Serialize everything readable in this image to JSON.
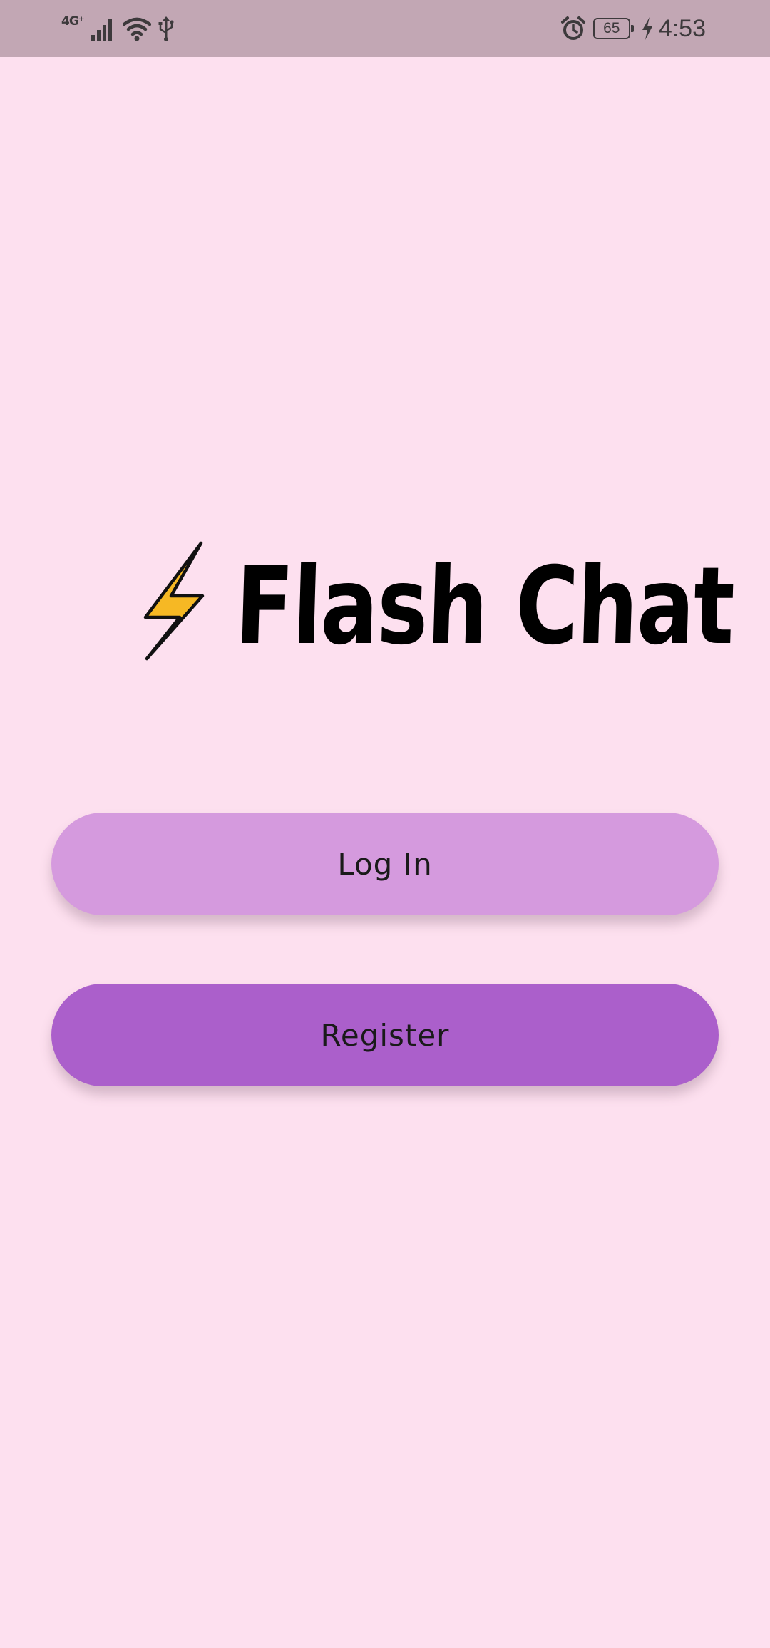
{
  "status_bar": {
    "network_label": "4G⁺",
    "battery_level": "65",
    "time": "4:53",
    "icons": [
      "signal-icon",
      "wifi-icon",
      "usb-icon",
      "alarm-icon",
      "battery-icon",
      "charging-icon"
    ]
  },
  "app": {
    "title": "Flash Chat",
    "logo_icon": "lightning-bolt-icon"
  },
  "buttons": {
    "login_label": "Log In",
    "register_label": "Register"
  },
  "colors": {
    "background": "#fde0ef",
    "status_bar": "#c2a7b4",
    "login_button": "#d59ade",
    "register_button": "#ab5fcb",
    "bolt_fill": "#f6b824"
  }
}
